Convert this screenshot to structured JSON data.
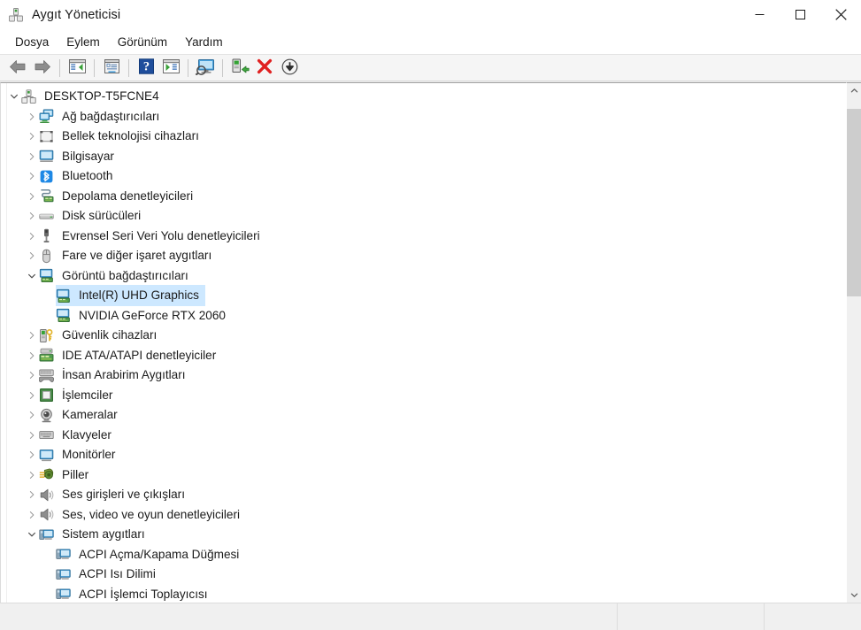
{
  "window": {
    "title": "Aygıt Yöneticisi",
    "app_icon": "device-manager-icon",
    "minimize_label": "—",
    "maximize_label": "□",
    "close_label": "✕"
  },
  "menubar": {
    "items": [
      {
        "label": "Dosya",
        "name": "menu-dosya"
      },
      {
        "label": "Eylem",
        "name": "menu-eylem"
      },
      {
        "label": "Görünüm",
        "name": "menu-gorunum"
      },
      {
        "label": "Yardım",
        "name": "menu-yardim"
      }
    ]
  },
  "toolbar": {
    "buttons": [
      {
        "icon": "back-arrow-icon",
        "name": "toolbar-back"
      },
      {
        "icon": "forward-arrow-icon",
        "name": "toolbar-forward"
      },
      {
        "icon": "show-hide-console-tree-icon",
        "name": "toolbar-console-tree"
      },
      {
        "icon": "properties-icon",
        "name": "toolbar-properties"
      },
      {
        "icon": "help-icon",
        "name": "toolbar-help"
      },
      {
        "icon": "scan-hardware-changes-icon",
        "name": "toolbar-scan-changes"
      },
      {
        "icon": "update-driver-icon",
        "name": "toolbar-update-driver"
      },
      {
        "icon": "enable-device-icon",
        "name": "toolbar-enable-device"
      },
      {
        "icon": "uninstall-device-icon",
        "name": "toolbar-uninstall-device"
      },
      {
        "icon": "disable-device-icon",
        "name": "toolbar-disable-device"
      }
    ]
  },
  "tree": {
    "root": {
      "label": "DESKTOP-T5FCNE4",
      "icon": "computer-root-icon",
      "expanded": true
    },
    "items": [
      {
        "label": "Ağ bağdaştırıcıları",
        "icon": "network-adapter-icon",
        "level": 1,
        "state": "collapsed",
        "selected": false
      },
      {
        "label": "Bellek teknolojisi cihazları",
        "icon": "memory-technology-icon",
        "level": 1,
        "state": "collapsed",
        "selected": false
      },
      {
        "label": "Bilgisayar",
        "icon": "computer-icon",
        "level": 1,
        "state": "collapsed",
        "selected": false
      },
      {
        "label": "Bluetooth",
        "icon": "bluetooth-icon",
        "level": 1,
        "state": "collapsed",
        "selected": false
      },
      {
        "label": "Depolama denetleyicileri",
        "icon": "storage-controller-icon",
        "level": 1,
        "state": "collapsed",
        "selected": false
      },
      {
        "label": "Disk sürücüleri",
        "icon": "disk-drive-icon",
        "level": 1,
        "state": "collapsed",
        "selected": false
      },
      {
        "label": "Evrensel Seri Veri Yolu denetleyicileri",
        "icon": "usb-controller-icon",
        "level": 1,
        "state": "collapsed",
        "selected": false
      },
      {
        "label": "Fare ve diğer işaret aygıtları",
        "icon": "mouse-icon",
        "level": 1,
        "state": "collapsed",
        "selected": false
      },
      {
        "label": "Görüntü bağdaştırıcıları",
        "icon": "display-adapter-icon",
        "level": 1,
        "state": "expanded",
        "selected": false
      },
      {
        "label": "Intel(R) UHD Graphics",
        "icon": "display-adapter-icon",
        "level": 2,
        "state": "leaf",
        "selected": true
      },
      {
        "label": "NVIDIA GeForce RTX 2060",
        "icon": "display-adapter-icon",
        "level": 2,
        "state": "leaf",
        "selected": false
      },
      {
        "label": "Güvenlik cihazları",
        "icon": "security-device-icon",
        "level": 1,
        "state": "collapsed",
        "selected": false
      },
      {
        "label": "IDE ATA/ATAPI denetleyiciler",
        "icon": "ide-controller-icon",
        "level": 1,
        "state": "collapsed",
        "selected": false
      },
      {
        "label": "İnsan Arabirim Aygıtları",
        "icon": "human-interface-device-icon",
        "level": 1,
        "state": "collapsed",
        "selected": false
      },
      {
        "label": "İşlemciler",
        "icon": "processor-icon",
        "level": 1,
        "state": "collapsed",
        "selected": false
      },
      {
        "label": "Kameralar",
        "icon": "camera-icon",
        "level": 1,
        "state": "collapsed",
        "selected": false
      },
      {
        "label": "Klavyeler",
        "icon": "keyboard-icon",
        "level": 1,
        "state": "collapsed",
        "selected": false
      },
      {
        "label": "Monitörler",
        "icon": "monitor-icon",
        "level": 1,
        "state": "collapsed",
        "selected": false
      },
      {
        "label": "Piller",
        "icon": "battery-icon",
        "level": 1,
        "state": "collapsed",
        "selected": false
      },
      {
        "label": "Ses girişleri ve çıkışları",
        "icon": "audio-input-output-icon",
        "level": 1,
        "state": "collapsed",
        "selected": false
      },
      {
        "label": "Ses, video ve oyun denetleyicileri",
        "icon": "sound-video-game-controller-icon",
        "level": 1,
        "state": "collapsed",
        "selected": false
      },
      {
        "label": "Sistem aygıtları",
        "icon": "system-device-icon",
        "level": 1,
        "state": "expanded",
        "selected": false
      },
      {
        "label": "ACPI Açma/Kapama Düğmesi",
        "icon": "system-device-icon",
        "level": 2,
        "state": "leaf",
        "selected": false
      },
      {
        "label": "ACPI Isı Dilimi",
        "icon": "system-device-icon",
        "level": 2,
        "state": "leaf",
        "selected": false
      },
      {
        "label": "ACPI İşlemci Toplayıcısı",
        "icon": "system-device-icon",
        "level": 2,
        "state": "leaf",
        "selected": false
      }
    ]
  },
  "scrollbar": {
    "up_arrow": "chevron-up-icon",
    "down_arrow": "chevron-down-icon"
  },
  "statusbar": {
    "cell1": "",
    "cell2": "",
    "cell3": ""
  },
  "colors": {
    "selection_bg": "#cde8ff",
    "toolbar_bg": "#f5f5f5",
    "statusbar_bg": "#f0f0f0",
    "text": "#1b1b1b",
    "scroll_thumb": "#cdcdcd"
  }
}
